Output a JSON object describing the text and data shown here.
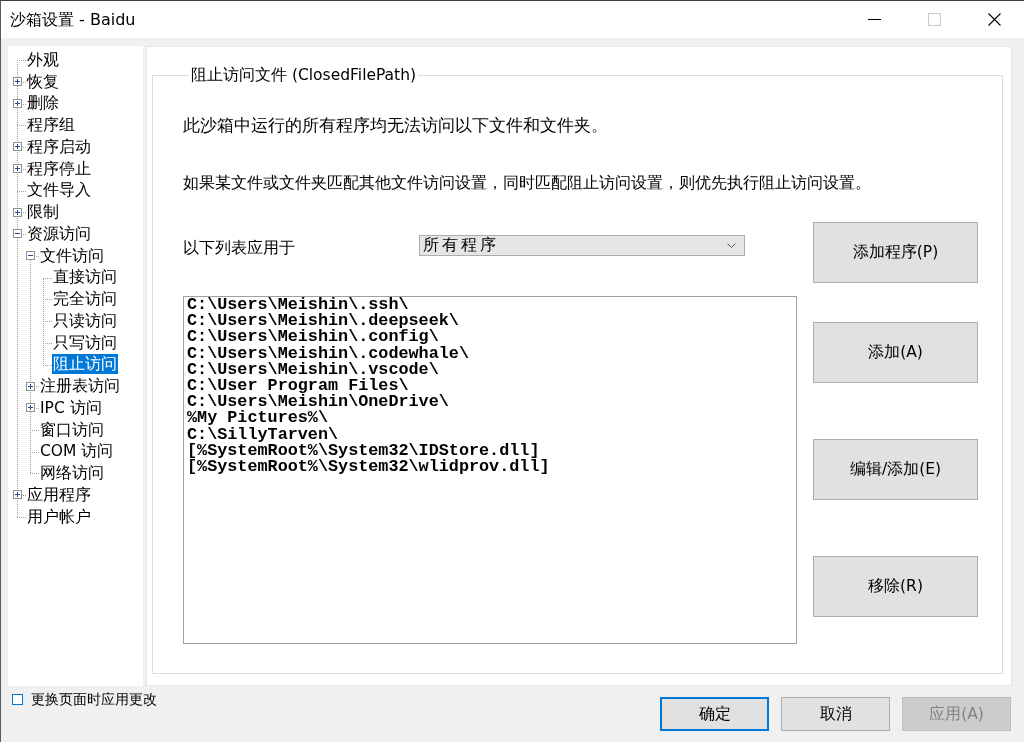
{
  "window": {
    "title": "沙箱设置 - Baidu",
    "controls": [
      {
        "kind": "minimize",
        "disabled": false
      },
      {
        "kind": "maximize",
        "disabled": true
      },
      {
        "kind": "close",
        "disabled": false
      }
    ]
  },
  "tree": [
    {
      "label": "外观",
      "selected": false
    },
    {
      "label": "恢复",
      "expanded": false,
      "selected": false
    },
    {
      "label": "删除",
      "expanded": false,
      "selected": false
    },
    {
      "label": "程序组",
      "selected": false
    },
    {
      "label": "程序启动",
      "expanded": false,
      "selected": false
    },
    {
      "label": "程序停止",
      "expanded": false,
      "selected": false
    },
    {
      "label": "文件导入",
      "selected": false
    },
    {
      "label": "限制",
      "expanded": false,
      "selected": false
    },
    {
      "label": "资源访问",
      "expanded": true,
      "selected": false,
      "children": [
        {
          "label": "文件访问",
          "expanded": true,
          "selected": false,
          "children": [
            {
              "label": "直接访问",
              "selected": false
            },
            {
              "label": "完全访问",
              "selected": false
            },
            {
              "label": "只读访问",
              "selected": false
            },
            {
              "label": "只写访问",
              "selected": false
            },
            {
              "label": "阻止访问",
              "selected": true
            }
          ]
        },
        {
          "label": "注册表访问",
          "expanded": false,
          "selected": false
        },
        {
          "label": "IPC 访问",
          "expanded": false,
          "selected": false
        },
        {
          "label": "窗口访问",
          "selected": false
        },
        {
          "label": "COM 访问",
          "selected": false
        },
        {
          "label": "网络访问",
          "selected": false
        }
      ]
    },
    {
      "label": "应用程序",
      "expanded": false,
      "selected": false
    },
    {
      "label": "用户帐户",
      "selected": false
    }
  ],
  "settings": {
    "title": "阻止访问文件 (ClosedFilePath)",
    "description": "此沙箱中运行的所有程序均无法访问以下文件和文件夹。",
    "note": "如果某文件或文件夹匹配其他文件访问设置，同时匹配阻止访问设置，则优先执行阻止访问设置。",
    "apply_to": {
      "label": "以下列表应用于",
      "value": "所有程序"
    },
    "paths": [
      "C:\\Users\\Meishin\\.ssh\\",
      "C:\\Users\\Meishin\\.deepseek\\",
      "C:\\Users\\Meishin\\.config\\",
      "C:\\Users\\Meishin\\.codewhale\\",
      "C:\\Users\\Meishin\\.vscode\\",
      "C:\\User Program Files\\",
      "C:\\Users\\Meishin\\OneDrive\\",
      "%My Pictures%\\",
      "C:\\SillyTarven\\",
      "[%SystemRoot%\\System32\\IDStore.dll]",
      "[%SystemRoot%\\System32\\wlidprov.dll]"
    ],
    "buttons": [
      "添加程序(P)",
      "添加(A)",
      "编辑/添加(E)",
      "移除(R)"
    ]
  },
  "footer": {
    "apply_on_page_change": {
      "label": "更换页面时应用更改",
      "checked": false
    },
    "buttons": [
      {
        "label": "确定",
        "focused": true,
        "disabled": false
      },
      {
        "label": "取消",
        "focused": false,
        "disabled": false
      },
      {
        "label": "应用(A)",
        "focused": false,
        "disabled": true
      }
    ]
  }
}
